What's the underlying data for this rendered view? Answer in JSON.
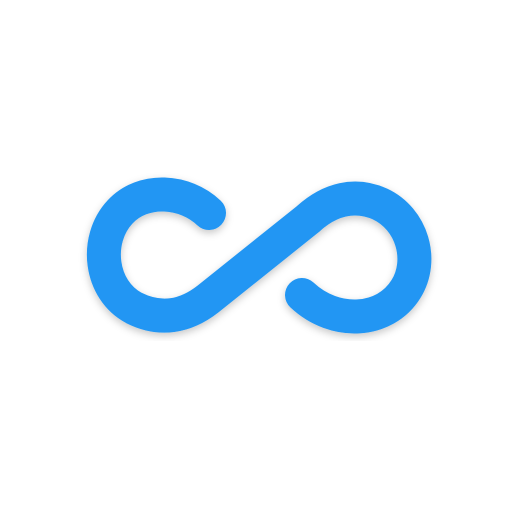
{
  "icon": {
    "name": "infinity-loop-icon",
    "stroke_color": "#2196F3",
    "background_color": "#ffffff"
  }
}
